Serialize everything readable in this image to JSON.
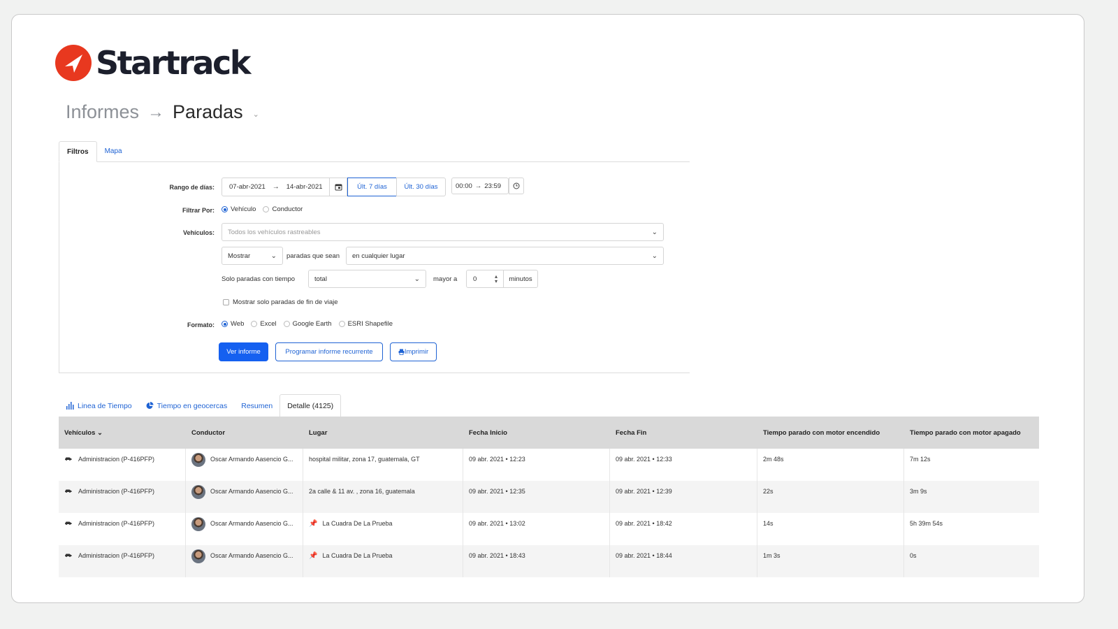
{
  "app": {
    "logo_text": "Startrack"
  },
  "breadcrumb": {
    "parent": "Informes",
    "arrow": "→",
    "current": "Paradas"
  },
  "filter_tabs": [
    "Filtros",
    "Mapa"
  ],
  "filters": {
    "range_label": "Rango de días:",
    "date_from": "07-abr-2021",
    "date_to": "14-abr-2021",
    "last7": "Últ. 7 días",
    "last30": "Últ. 30 días",
    "time_from": "00:00",
    "time_to": "23:59",
    "filter_by_label": "Filtrar Por:",
    "filter_by_options": [
      "Vehículo",
      "Conductor"
    ],
    "vehicles_label": "Vehículos:",
    "vehicles_placeholder": "Todos los vehículos rastreables",
    "show_select": "Mostrar",
    "stops_that_are": "paradas que sean",
    "location_select": "en cualquier lugar",
    "only_stops_time": "Solo paradas con tiempo",
    "time_type_select": "total",
    "greater_than": "mayor a",
    "minutes_value": "0",
    "minutes_unit": "minutos",
    "trip_end_checkbox": "Mostrar solo paradas de fin de viaje",
    "format_label": "Formato:",
    "format_options": [
      "Web",
      "Excel",
      "Google Earth",
      "ESRI Shapefile"
    ]
  },
  "actions": {
    "view_report": "Ver informe",
    "schedule_report": "Programar informe recurrente",
    "print": "Imprimir"
  },
  "result_tabs": [
    "Linea de Tiempo",
    "Tiempo en geocercas",
    "Resumen",
    "Detalle (4125)"
  ],
  "table": {
    "headers": [
      "Vehículos ⌄",
      "Conductor",
      "Lugar",
      "Fecha Inicio",
      "Fecha Fin",
      "Tiempo parado con motor encendido",
      "Tiempo parado con motor apagado"
    ],
    "rows": [
      [
        "Administracion (P-416PFP)",
        "Oscar Armando Aasencio G...",
        "hospital militar, zona 17, guatemala, GT",
        "09 abr. 2021 • 12:23",
        "09 abr. 2021 • 12:33",
        "2m 48s",
        "7m 12s"
      ],
      [
        "Administracion (P-416PFP)",
        "Oscar Armando Aasencio G...",
        "2a calle & 11 av. , zona 16, guatemala",
        "09 abr. 2021 • 12:35",
        "09 abr. 2021 • 12:39",
        "22s",
        "3m 9s"
      ],
      [
        "Administracion (P-416PFP)",
        "Oscar Armando Aasencio G...",
        "La Cuadra De La Prueba",
        "09 abr. 2021 • 13:02",
        "09 abr. 2021 • 18:42",
        "14s",
        "5h 39m 54s"
      ],
      [
        "Administracion (P-416PFP)",
        "Oscar Armando Aasencio G...",
        "La Cuadra De La Prueba",
        "09 abr. 2021 • 18:43",
        "09 abr. 2021 • 18:44",
        "1m 3s",
        "0s"
      ]
    ]
  },
  "colors": {
    "accent": "#1560f0",
    "brand_red": "#e8381f",
    "header_bg": "#d9d9d9"
  }
}
